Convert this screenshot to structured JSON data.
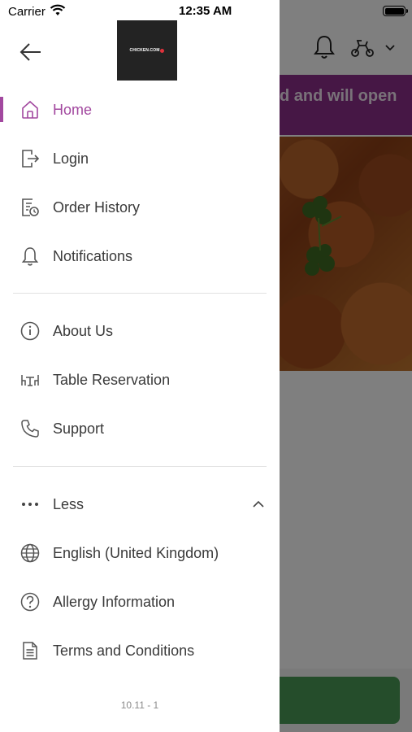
{
  "status_bar": {
    "carrier": "Carrier",
    "time": "12:35 AM"
  },
  "background": {
    "banner_text": "d and will open",
    "banner_color": "#8c2e8a",
    "button_color": "#4b9a57"
  },
  "drawer": {
    "logo_text": "CHICKEN.COM",
    "accent_color": "#a2489f",
    "main_items": [
      {
        "label": "Home",
        "icon": "home-icon",
        "active": true
      },
      {
        "label": "Login",
        "icon": "login-icon",
        "active": false
      },
      {
        "label": "Order History",
        "icon": "order-history-icon",
        "active": false
      },
      {
        "label": "Notifications",
        "icon": "bell-icon",
        "active": false
      }
    ],
    "secondary_items": [
      {
        "label": "About Us",
        "icon": "info-icon"
      },
      {
        "label": "Table Reservation",
        "icon": "table-icon"
      },
      {
        "label": "Support",
        "icon": "phone-icon"
      }
    ],
    "more_toggle": {
      "label": "Less",
      "icon": "more-dots-icon"
    },
    "extra_items": [
      {
        "label": "English (United Kingdom)",
        "icon": "globe-icon"
      },
      {
        "label": "Allergy Information",
        "icon": "question-icon"
      },
      {
        "label": "Terms and Conditions",
        "icon": "document-icon"
      }
    ],
    "version": "10.11 - 1"
  }
}
